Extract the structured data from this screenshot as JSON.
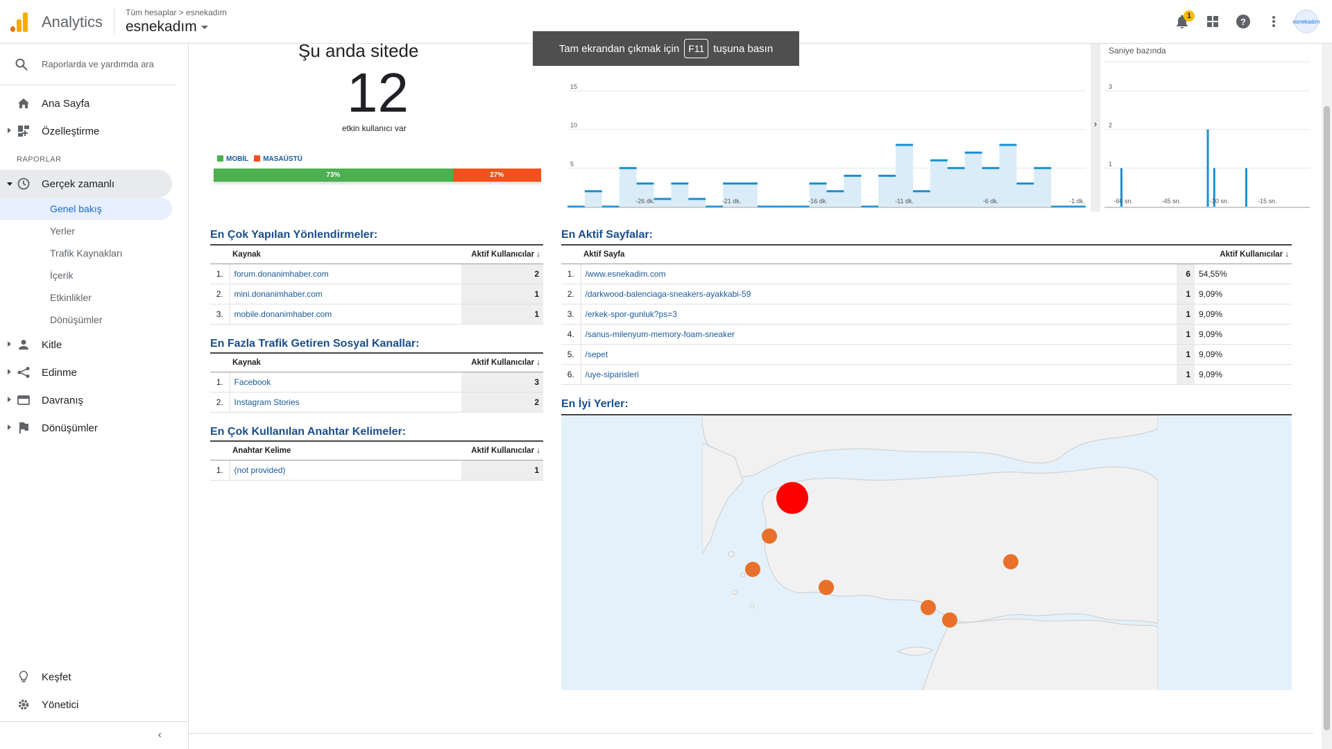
{
  "header": {
    "app_name": "Analytics",
    "breadcrumb": "Tüm hesaplar  >  esnekadım",
    "account": "esnekadım",
    "notifications": "1",
    "avatar_text": "esnekadım"
  },
  "toast": {
    "before": "Tam ekrandan çıkmak için",
    "key": "F11",
    "after": "tuşuna basın"
  },
  "sidebar": {
    "search_placeholder": "Raporlarda ve yardımda ara",
    "home": "Ana Sayfa",
    "customization": "Özelleştirme",
    "reports_label": "RAPORLAR",
    "realtime": "Gerçek zamanlı",
    "realtime_items": [
      "Genel bakış",
      "Yerler",
      "Trafik Kaynakları",
      "İçerik",
      "Etkinlikler",
      "Dönüşümler"
    ],
    "audience": "Kitle",
    "acquisition": "Edinme",
    "behavior": "Davranış",
    "conversions": "Dönüşümler",
    "discover": "Keşfet",
    "admin": "Yönetici"
  },
  "overview": {
    "title": "Şu anda sitede",
    "active_count": "12",
    "subtitle": "etkin kullanıcı var",
    "legend_mobile": "MOBİL",
    "legend_desktop": "MASAÜSTÜ",
    "mobile_pct": "73%",
    "desktop_pct": "27%",
    "mobile_share": 0.73,
    "colors": {
      "mobile": "#4caf50",
      "desktop": "#f4511e",
      "accent": "#1a5a9a",
      "bars": "#1a8fd1"
    }
  },
  "chart_data": [
    {
      "type": "bar",
      "title": "",
      "x": [
        "-30 dk.",
        "-29",
        "-28",
        "-27",
        "-26",
        "-25",
        "-24",
        "-23",
        "-22",
        "-21",
        "-20",
        "-19",
        "-18",
        "-17",
        "-16",
        "-15",
        "-14",
        "-13",
        "-12",
        "-11",
        "-10",
        "-9",
        "-8",
        "-7",
        "-6",
        "-5",
        "-4",
        "-3",
        "-2",
        "-1 dk."
      ],
      "x_tick_labels": [
        "-26 dk.",
        "-21 dk.",
        "-16 dk.",
        "-11 dk.",
        "-6 dk.",
        "-1 dk."
      ],
      "values": [
        0,
        2,
        0,
        5,
        3,
        1,
        3,
        1,
        0,
        3,
        3,
        0,
        0,
        0,
        3,
        2,
        4,
        0,
        4,
        8,
        2,
        6,
        5,
        7,
        5,
        8,
        3,
        5,
        0,
        0
      ],
      "y_ticks": [
        5,
        10,
        15
      ],
      "ylim": [
        0,
        15
      ]
    },
    {
      "type": "bar",
      "title": "Saniye bazında",
      "x_tick_labels": [
        "-60 sn.",
        "-45 sn.",
        "-30 sn.",
        "-15 sn."
      ],
      "points": [
        {
          "sec": -58,
          "value": 1
        },
        {
          "sec": -31,
          "value": 2
        },
        {
          "sec": -29,
          "value": 1
        },
        {
          "sec": -19,
          "value": 1
        }
      ],
      "y_ticks": [
        1,
        2,
        3
      ],
      "ylim": [
        0,
        3
      ]
    }
  ],
  "referrals": {
    "title": "En Çok Yapılan Yönlendirmeler:",
    "col_source": "Kaynak",
    "col_users": "Aktif Kullanıcılar",
    "rows": [
      {
        "n": "1.",
        "source": "forum.donanimhaber.com",
        "users": "2"
      },
      {
        "n": "2.",
        "source": "mini.donanimhaber.com",
        "users": "1"
      },
      {
        "n": "3.",
        "source": "mobile.donanimhaber.com",
        "users": "1"
      }
    ]
  },
  "social": {
    "title": "En Fazla Trafik Getiren Sosyal Kanallar:",
    "col_source": "Kaynak",
    "col_users": "Aktif Kullanıcılar",
    "rows": [
      {
        "n": "1.",
        "source": "Facebook",
        "users": "3"
      },
      {
        "n": "2.",
        "source": "Instagram Stories",
        "users": "2"
      }
    ]
  },
  "keywords": {
    "title": "En Çok Kullanılan Anahtar Kelimeler:",
    "col_keyword": "Anahtar Kelime",
    "col_users": "Aktif Kullanıcılar",
    "rows": [
      {
        "n": "1.",
        "keyword": "(not provided)",
        "users": "1"
      }
    ]
  },
  "pages": {
    "title": "En Aktif Sayfalar:",
    "col_page": "Aktif Sayfa",
    "col_users": "Aktif Kullanıcılar",
    "rows": [
      {
        "n": "1.",
        "page": "/www.esnekadim.com",
        "users": "6",
        "pct": "54,55%"
      },
      {
        "n": "2.",
        "page": "/darkwood-balenciaga-sneakers-ayakkabi-59",
        "users": "1",
        "pct": "9,09%"
      },
      {
        "n": "3.",
        "page": "/erkek-spor-gunluk?ps=3",
        "users": "1",
        "pct": "9,09%"
      },
      {
        "n": "4.",
        "page": "/sanus-milenyum-memory-foam-sneaker",
        "users": "1",
        "pct": "9,09%"
      },
      {
        "n": "5.",
        "page": "/sepet",
        "users": "1",
        "pct": "9,09%"
      },
      {
        "n": "6.",
        "page": "/uye-siparisleri",
        "users": "1",
        "pct": "9,09%"
      }
    ]
  },
  "locations": {
    "title": "En İyi Yerler:"
  }
}
